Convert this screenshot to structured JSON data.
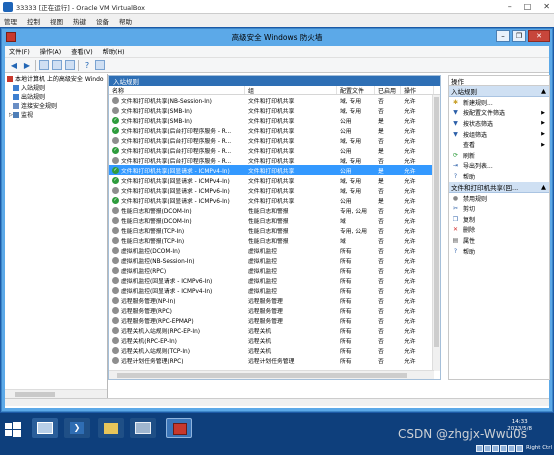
{
  "vbox": {
    "title": "33333 [正在运行] - Oracle VM VirtualBox",
    "menu": [
      "管理",
      "控制",
      "视图",
      "热键",
      "设备",
      "帮助"
    ]
  },
  "window": {
    "title": "高级安全 Windows 防火墙",
    "menu": [
      "文件(F)",
      "操作(A)",
      "查看(V)",
      "帮助(H)"
    ]
  },
  "tree": {
    "root": "本地计算机 上的高级安全 Windo",
    "items": [
      "入站规则",
      "出站规则",
      "连接安全规则",
      "监视"
    ]
  },
  "panel": {
    "title": "入站规则",
    "columns": [
      "名称",
      "组",
      "配置文件",
      "已启用",
      "操作"
    ]
  },
  "rules": [
    {
      "name": "文件和打印机共享(NB-Session-In)",
      "group": "文件和打印机共享",
      "profile": "域, 专用",
      "enabled": "否",
      "action": "允许",
      "on": false,
      "sel": false
    },
    {
      "name": "文件和打印机共享(SMB-In)",
      "group": "文件和打印机共享",
      "profile": "域, 专用",
      "enabled": "否",
      "action": "允许",
      "on": false,
      "sel": false
    },
    {
      "name": "文件和打印机共享(SMB-In)",
      "group": "文件和打印机共享",
      "profile": "公用",
      "enabled": "是",
      "action": "允许",
      "on": true,
      "sel": false
    },
    {
      "name": "文件和打印机共享(后台打印程序服务 - R...",
      "group": "文件和打印机共享",
      "profile": "公用",
      "enabled": "是",
      "action": "允许",
      "on": true,
      "sel": false
    },
    {
      "name": "文件和打印机共享(后台打印程序服务 - R...",
      "group": "文件和打印机共享",
      "profile": "域, 专用",
      "enabled": "否",
      "action": "允许",
      "on": false,
      "sel": false
    },
    {
      "name": "文件和打印机共享(后台打印程序服务 - R...",
      "group": "文件和打印机共享",
      "profile": "公用",
      "enabled": "是",
      "action": "允许",
      "on": true,
      "sel": false
    },
    {
      "name": "文件和打印机共享(后台打印程序服务 - R...",
      "group": "文件和打印机共享",
      "profile": "域, 专用",
      "enabled": "否",
      "action": "允许",
      "on": false,
      "sel": false
    },
    {
      "name": "文件和打印机共享(回显请求 - ICMPv4-In)",
      "group": "文件和打印机共享",
      "profile": "公用",
      "enabled": "是",
      "action": "允许",
      "on": true,
      "sel": true
    },
    {
      "name": "文件和打印机共享(回显请求 - ICMPv4-In)",
      "group": "文件和打印机共享",
      "profile": "域, 专用",
      "enabled": "是",
      "action": "允许",
      "on": true,
      "sel": false
    },
    {
      "name": "文件和打印机共享(回显请求 - ICMPv6-In)",
      "group": "文件和打印机共享",
      "profile": "域, 专用",
      "enabled": "否",
      "action": "允许",
      "on": false,
      "sel": false
    },
    {
      "name": "文件和打印机共享(回显请求 - ICMPv6-In)",
      "group": "文件和打印机共享",
      "profile": "公用",
      "enabled": "是",
      "action": "允许",
      "on": true,
      "sel": false
    },
    {
      "name": "性能日志和警报(DCOM-In)",
      "group": "性能日志和警报",
      "profile": "专用, 公用",
      "enabled": "否",
      "action": "允许",
      "on": false,
      "sel": false
    },
    {
      "name": "性能日志和警报(DCOM-In)",
      "group": "性能日志和警报",
      "profile": "域",
      "enabled": "否",
      "action": "允许",
      "on": false,
      "sel": false
    },
    {
      "name": "性能日志和警报(TCP-In)",
      "group": "性能日志和警报",
      "profile": "专用, 公用",
      "enabled": "否",
      "action": "允许",
      "on": false,
      "sel": false
    },
    {
      "name": "性能日志和警报(TCP-In)",
      "group": "性能日志和警报",
      "profile": "域",
      "enabled": "否",
      "action": "允许",
      "on": false,
      "sel": false
    },
    {
      "name": "虚拟机监控(DCOM-In)",
      "group": "虚拟机监控",
      "profile": "所有",
      "enabled": "否",
      "action": "允许",
      "on": false,
      "sel": false
    },
    {
      "name": "虚拟机监控(NB-Session-In)",
      "group": "虚拟机监控",
      "profile": "所有",
      "enabled": "否",
      "action": "允许",
      "on": false,
      "sel": false
    },
    {
      "name": "虚拟机监控(RPC)",
      "group": "虚拟机监控",
      "profile": "所有",
      "enabled": "否",
      "action": "允许",
      "on": false,
      "sel": false
    },
    {
      "name": "虚拟机监控(回显请求 - ICMPv6-In)",
      "group": "虚拟机监控",
      "profile": "所有",
      "enabled": "否",
      "action": "允许",
      "on": false,
      "sel": false
    },
    {
      "name": "虚拟机监控(回显请求 - ICMPv4-In)",
      "group": "虚拟机监控",
      "profile": "所有",
      "enabled": "否",
      "action": "允许",
      "on": false,
      "sel": false
    },
    {
      "name": "远程服务管理(NP-In)",
      "group": "远程服务管理",
      "profile": "所有",
      "enabled": "否",
      "action": "允许",
      "on": false,
      "sel": false
    },
    {
      "name": "远程服务管理(RPC)",
      "group": "远程服务管理",
      "profile": "所有",
      "enabled": "否",
      "action": "允许",
      "on": false,
      "sel": false
    },
    {
      "name": "远程服务管理(RPC-EPMAP)",
      "group": "远程服务管理",
      "profile": "所有",
      "enabled": "否",
      "action": "允许",
      "on": false,
      "sel": false
    },
    {
      "name": "远程关机入站规则(RPC-EP-In)",
      "group": "远程关机",
      "profile": "所有",
      "enabled": "否",
      "action": "允许",
      "on": false,
      "sel": false
    },
    {
      "name": "远程关机(RPC-EP-In)",
      "group": "远程关机",
      "profile": "所有",
      "enabled": "否",
      "action": "允许",
      "on": false,
      "sel": false
    },
    {
      "name": "远程关机入站规则(TCP-In)",
      "group": "远程关机",
      "profile": "所有",
      "enabled": "否",
      "action": "允许",
      "on": false,
      "sel": false
    },
    {
      "name": "远程计划任务管理(RPC)",
      "group": "远程计划任务管理",
      "profile": "所有",
      "enabled": "否",
      "action": "允许",
      "on": false,
      "sel": false
    }
  ],
  "actions": {
    "header": "操作",
    "section1": "入站规则",
    "items1": [
      {
        "label": "新建规则...",
        "icon": "new-rule-icon",
        "glyph": "✱",
        "color": "#c8a02a",
        "arrow": ""
      },
      {
        "label": "按配置文件筛选",
        "icon": "filter-icon",
        "glyph": "▼",
        "color": "#2b5fa8",
        "arrow": "▶"
      },
      {
        "label": "按状态筛选",
        "icon": "filter-icon",
        "glyph": "▼",
        "color": "#2b5fa8",
        "arrow": "▶"
      },
      {
        "label": "按组筛选",
        "icon": "filter-icon",
        "glyph": "▼",
        "color": "#2b5fa8",
        "arrow": "▶"
      },
      {
        "label": "查看",
        "icon": "view-icon",
        "glyph": "",
        "color": "#333",
        "arrow": "▶"
      },
      {
        "label": "刷新",
        "icon": "refresh-icon",
        "glyph": "⟳",
        "color": "#2e9c3c",
        "arrow": ""
      },
      {
        "label": "导出列表...",
        "icon": "export-icon",
        "glyph": "⇥",
        "color": "#2b5fa8",
        "arrow": ""
      },
      {
        "label": "帮助",
        "icon": "help-icon",
        "glyph": "?",
        "color": "#2b5fa8",
        "arrow": ""
      }
    ],
    "section2": "文件和打印机共享(回...",
    "items2": [
      {
        "label": "禁用规则",
        "icon": "disable-rule-icon",
        "glyph": "●",
        "color": "#888",
        "arrow": ""
      },
      {
        "label": "剪切",
        "icon": "cut-icon",
        "glyph": "✂",
        "color": "#2b5fa8",
        "arrow": ""
      },
      {
        "label": "复制",
        "icon": "copy-icon",
        "glyph": "❐",
        "color": "#2b5fa8",
        "arrow": ""
      },
      {
        "label": "删除",
        "icon": "delete-icon",
        "glyph": "✕",
        "color": "#d32f2f",
        "arrow": ""
      },
      {
        "label": "属性",
        "icon": "properties-icon",
        "glyph": "▤",
        "color": "#555",
        "arrow": ""
      },
      {
        "label": "帮助",
        "icon": "help-icon",
        "glyph": "?",
        "color": "#2b5fa8",
        "arrow": ""
      }
    ]
  },
  "tray": {
    "time": "14:33",
    "date": "2023/5/8",
    "host": "Right Ctrl"
  },
  "watermark": "CSDN @zhgjx-Wwu0s"
}
